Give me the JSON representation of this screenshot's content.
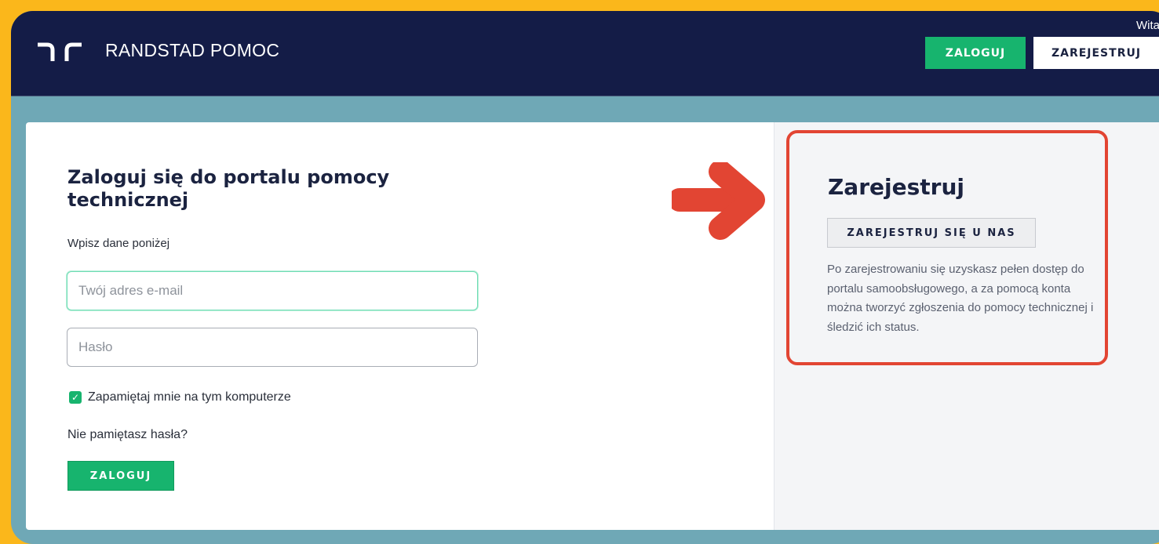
{
  "header": {
    "brand": "RANDSTAD POMOC",
    "welcome": "Witamy",
    "login_button": "ZALOGUJ",
    "register_button": "ZAREJESTRUJ"
  },
  "login": {
    "title": "Zaloguj się do portalu pomocy technicznej",
    "subtitle": "Wpisz dane poniżej",
    "email_placeholder": "Twój adres e-mail",
    "password_placeholder": "Hasło",
    "remember_label": "Zapamiętaj mnie na tym komputerze",
    "remember_checked": true,
    "forgot_link": "Nie pamiętasz hasła?",
    "submit_button": "ZALOGUJ"
  },
  "register": {
    "title": "Zarejestruj",
    "button": "ZAREJESTRUJ SIĘ U NAS",
    "description": "Po zarejestrowaniu się uzyskasz pełen dostęp do portalu samoobsługowego, a za pomocą konta można tworzyć zgłoszenia do pomocy technicznej i śledzić ich status."
  },
  "colors": {
    "outer_background": "#FBB71B",
    "header_background": "#141C47",
    "page_background": "#6FA8B6",
    "accent_green": "#17B46E",
    "highlight_red": "#E24533"
  },
  "icons": {
    "logo": "randstad-logo-icon",
    "checkbox": "checkmark-icon",
    "annotation": "arrow-right-icon"
  }
}
